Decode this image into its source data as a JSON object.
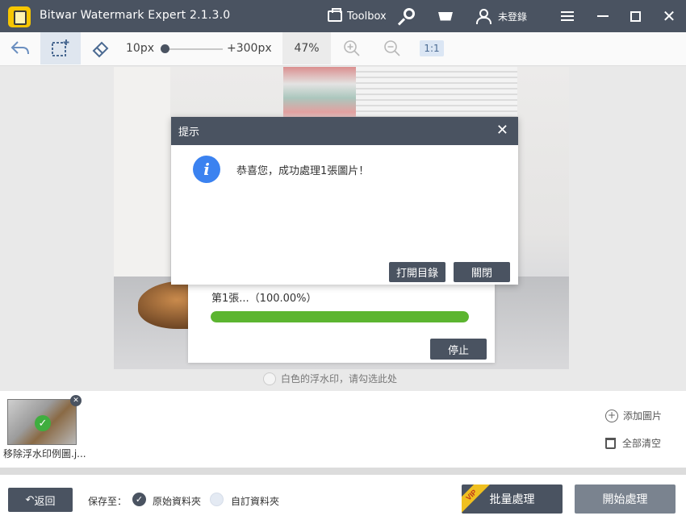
{
  "titlebar": {
    "app_title": "Bitwar Watermark Expert  2.1.3.0",
    "toolbox_label": "Toolbox",
    "user_label": "未登錄"
  },
  "toolbar": {
    "brush_min": "10px",
    "brush_max": "+300px",
    "zoom": "47%",
    "one_to_one": "1:1"
  },
  "canvas": {
    "watermark_hint": "白色的浮水印，请勾选此处"
  },
  "progress": {
    "text": "第1張...（100.00%）",
    "percent": 1.0,
    "stop_label": "停止"
  },
  "dialog": {
    "title": "提示",
    "message": "恭喜您，成功處理1張圖片！",
    "open_dir_label": "打開目錄",
    "close_label": "關閉"
  },
  "thumbnails": [
    {
      "name": "移除浮水印例圖.j..."
    }
  ],
  "side_actions": {
    "add_image": "添加圖片",
    "clear_all": "全部清空"
  },
  "footer": {
    "back_label": "返回",
    "save_to": "保存至：",
    "option_original": "原始資料夾",
    "option_custom": "自訂資料夾",
    "vip": "VIP",
    "batch_label": "批量處理",
    "start_label": "開始處理"
  },
  "colors": {
    "header": "#4a5361",
    "progress": "#5cb530",
    "info": "#3b82f0"
  }
}
